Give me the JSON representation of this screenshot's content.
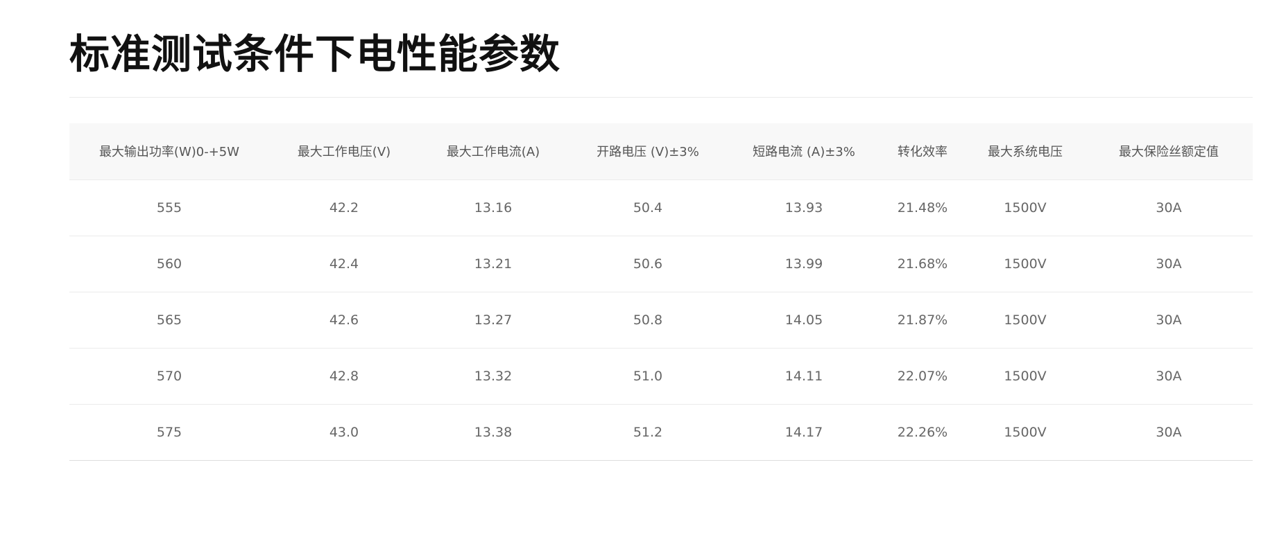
{
  "page": {
    "title": "标准测试条件下电性能参数"
  },
  "table": {
    "headers": [
      "最大输出功率(W)0-+5W",
      "最大工作电压(V)",
      "最大工作电流(A)",
      "开路电压 (V)±3%",
      "短路电流 (A)±3%",
      "转化效率",
      "最大系统电压",
      "最大保险丝额定值"
    ],
    "rows": [
      [
        "555",
        "42.2",
        "13.16",
        "50.4",
        "13.93",
        "21.48%",
        "1500V",
        "30A"
      ],
      [
        "560",
        "42.4",
        "13.21",
        "50.6",
        "13.99",
        "21.68%",
        "1500V",
        "30A"
      ],
      [
        "565",
        "42.6",
        "13.27",
        "50.8",
        "14.05",
        "21.87%",
        "1500V",
        "30A"
      ],
      [
        "570",
        "42.8",
        "13.32",
        "51.0",
        "14.11",
        "22.07%",
        "1500V",
        "30A"
      ],
      [
        "575",
        "43.0",
        "13.38",
        "51.2",
        "14.17",
        "22.26%",
        "1500V",
        "30A"
      ]
    ]
  }
}
